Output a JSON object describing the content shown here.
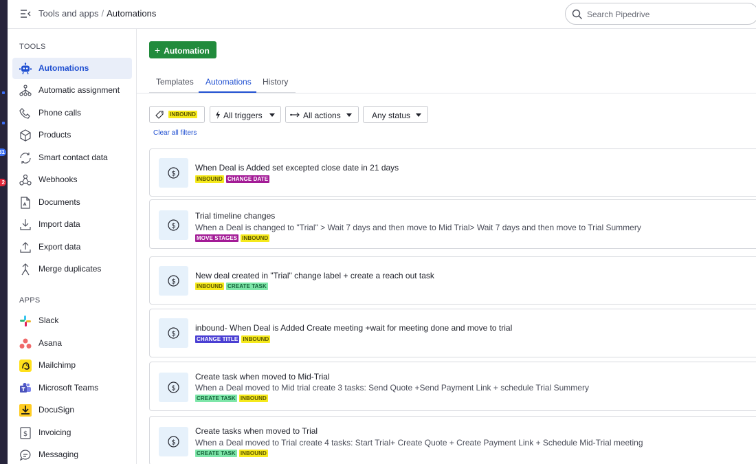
{
  "header": {
    "breadcrumb_parent": "Tools and apps",
    "breadcrumb_separator": "/",
    "breadcrumb_current": "Automations",
    "search_placeholder": "Search Pipedrive"
  },
  "app_strip": {
    "badges": [
      "31",
      "2"
    ]
  },
  "sidebar": {
    "tools_heading": "TOOLS",
    "tools": [
      {
        "label": "Automations",
        "icon": "automations-robot-icon",
        "active": true
      },
      {
        "label": "Automatic assignment",
        "icon": "assignment-nodes-icon"
      },
      {
        "label": "Phone calls",
        "icon": "phone-icon"
      },
      {
        "label": "Products",
        "icon": "product-box-icon"
      },
      {
        "label": "Smart contact data",
        "icon": "refresh-icon"
      },
      {
        "label": "Webhooks",
        "icon": "webhook-icon"
      },
      {
        "label": "Documents",
        "icon": "document-icon"
      },
      {
        "label": "Import data",
        "icon": "import-icon"
      },
      {
        "label": "Export data",
        "icon": "export-icon"
      },
      {
        "label": "Merge duplicates",
        "icon": "merge-icon"
      }
    ],
    "apps_heading": "APPS",
    "apps": [
      {
        "label": "Slack",
        "icon": "slack-icon"
      },
      {
        "label": "Asana",
        "icon": "asana-icon"
      },
      {
        "label": "Mailchimp",
        "icon": "mailchimp-icon"
      },
      {
        "label": "Microsoft Teams",
        "icon": "microsoft-teams-icon"
      },
      {
        "label": "DocuSign",
        "icon": "docusign-icon"
      },
      {
        "label": "Invoicing",
        "icon": "invoice-icon"
      },
      {
        "label": "Messaging",
        "icon": "messaging-icon"
      }
    ]
  },
  "main": {
    "add_button_label": "Automation",
    "tabs": [
      {
        "label": "Templates"
      },
      {
        "label": "Automations",
        "active": true
      },
      {
        "label": "History"
      }
    ],
    "filters": {
      "tag_filter_value": "INBOUND",
      "triggers_label": "All triggers",
      "actions_label": "All actions",
      "status_label": "Any status",
      "clear_label": "Clear all filters"
    },
    "automations": [
      {
        "title": "When Deal is Added set excepted close date in 21 days",
        "description": "",
        "tags": [
          "INBOUND",
          "CHANGE DATE"
        ]
      },
      {
        "title": "Trial timeline changes",
        "description": "When a Deal is changed to \"Trial\" > Wait 7 days and then move to Mid Trial> Wait 7 days and then move to Trial Summery",
        "tags": [
          "MOVE STAGES",
          "INBOUND"
        ]
      },
      {
        "title": "New deal created in \"Trial\" change label + create a reach out task",
        "description": "",
        "tags": [
          "INBOUND",
          "CREATE TASK"
        ]
      },
      {
        "title": "inbound- When Deal is Added Create meeting +wait for meeting done and move to trial",
        "description": "",
        "tags": [
          "CHANGE TITLE",
          "INBOUND"
        ]
      },
      {
        "title": "Create task when moved to Mid-Trial",
        "description": "When a Deal moved to Mid trial create 3 tasks: Send Quote +Send Payment Link + schedule Trial Summery",
        "tags": [
          "CREATE TASK",
          "INBOUND"
        ]
      },
      {
        "title": "Create tasks when moved to Trial",
        "description": "When a Deal moved to Trial create 4 tasks: Start Trial+ Create Quote + Create Payment Link + Schedule Mid-Trial meeting",
        "tags": [
          "CREATE TASK",
          "INBOUND"
        ]
      }
    ]
  },
  "colors": {
    "accent_blue": "#1f4fd1",
    "primary_green": "#218b3c",
    "tag_inbound": "#f5e91c",
    "tag_purple": "#a31b96",
    "tag_green": "#7ee6a9",
    "tag_indigo": "#4a3fd3"
  }
}
